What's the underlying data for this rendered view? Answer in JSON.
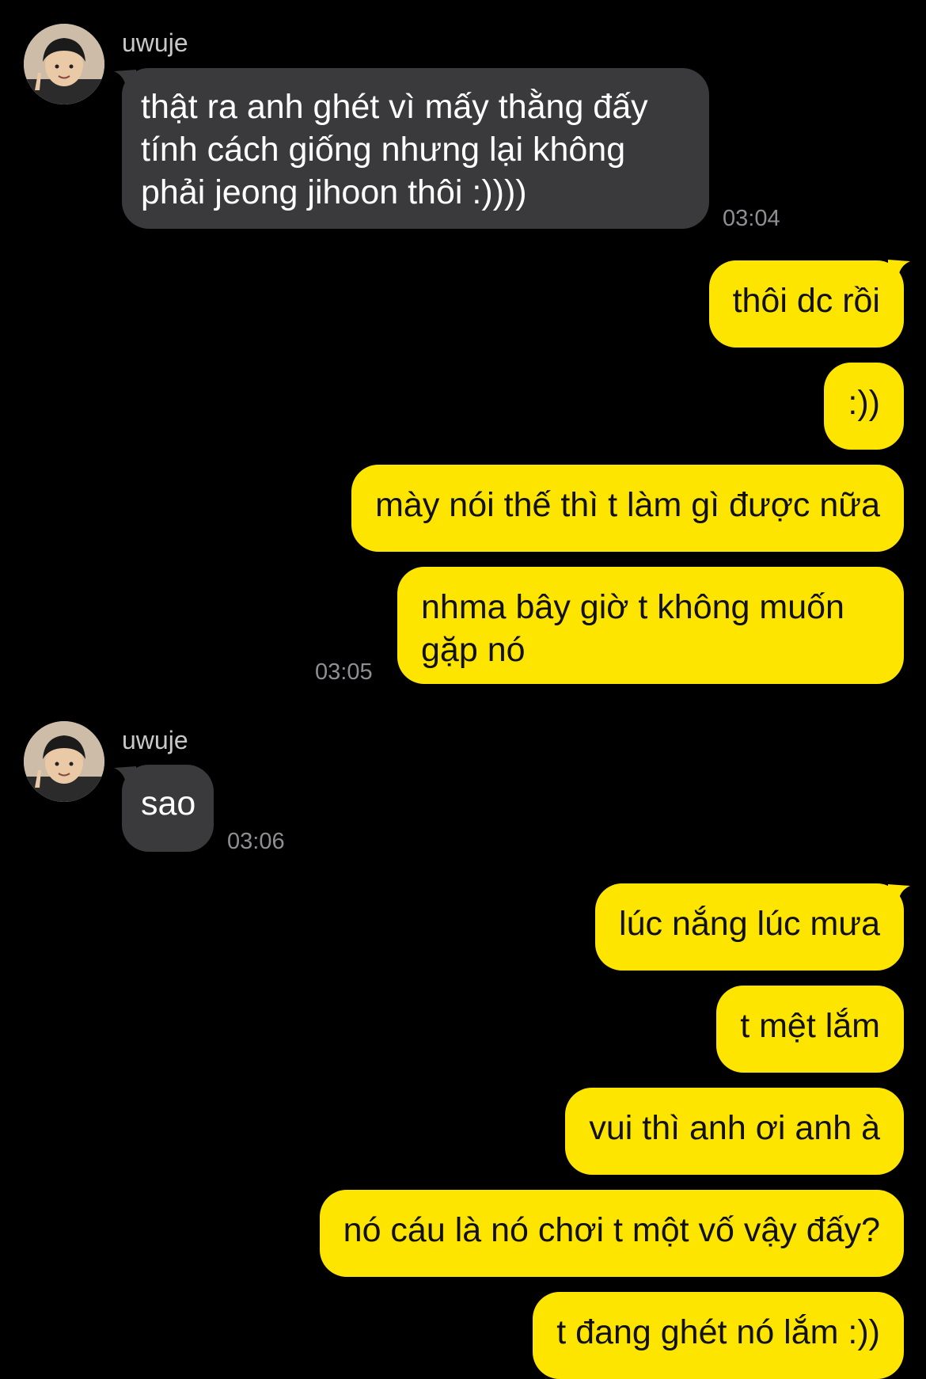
{
  "colors": {
    "background": "#000000",
    "incoming_bubble": "#3a3a3c",
    "outgoing_bubble": "#fee500",
    "timestamp": "#8e8e93",
    "sender_name": "#c8c8c8"
  },
  "messages": [
    {
      "sender": "uwuje",
      "text": "thật ra anh ghét vì mấy thằng đấy\ntính cách giống nhưng lại không\nphải jeong jihoon thôi :))))",
      "time": "03:04"
    },
    {
      "text": "thôi dc rồi"
    },
    {
      "text": ":))"
    },
    {
      "text": "mày nói thế thì t làm gì được nữa"
    },
    {
      "text": "nhma bây giờ t không muốn\ngặp nó",
      "time": "03:05"
    },
    {
      "sender": "uwuje",
      "text": "sao",
      "time": "03:06"
    },
    {
      "text": "lúc nắng lúc mưa"
    },
    {
      "text": "t mệt lắm"
    },
    {
      "text": "vui thì anh ơi anh à"
    },
    {
      "text": "nó cáu là nó chơi t một vố vậy đấy?"
    },
    {
      "text": "t đang ghét nó lắm :))"
    }
  ]
}
